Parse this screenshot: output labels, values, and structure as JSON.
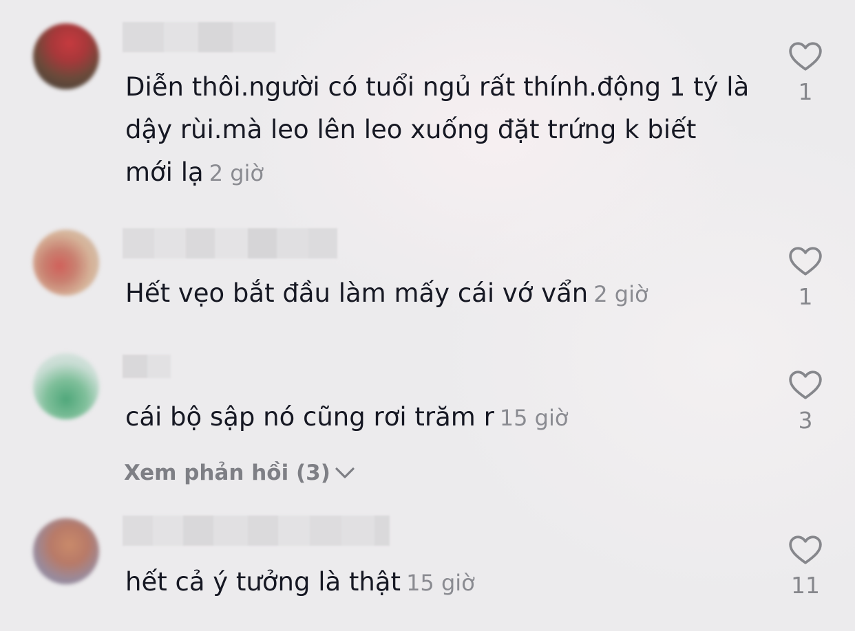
{
  "comments": [
    {
      "text": "Diễn thôi.người có tuổi ngủ rất thính.động 1 tý là dậy rùi.mà leo lên leo xuống đặt trứng k biết mới lạ",
      "time": "2 giờ",
      "likes": "1"
    },
    {
      "text": "Hết vẹo bắt đầu làm mấy cái vớ vẩn",
      "time": "2 giờ",
      "likes": "1"
    },
    {
      "text": "cái bộ sập nó cũng rơi trăm r",
      "time": "15 giờ",
      "likes": "3",
      "replies_label": "Xem phản hồi (3)"
    },
    {
      "text": "hết cả ý tưởng là thật",
      "time": "15 giờ",
      "likes": "11"
    }
  ],
  "icons": {
    "like": "heart-outline-icon",
    "expand": "chevron-down-icon"
  },
  "colors": {
    "text": "#161823",
    "secondary": "#8a8b91",
    "icon": "#86878c"
  }
}
